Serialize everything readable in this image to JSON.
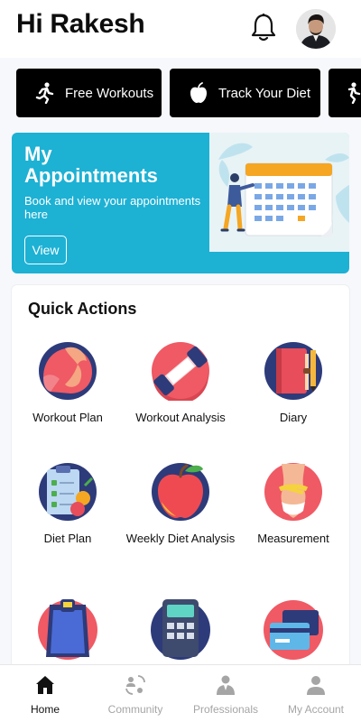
{
  "header": {
    "greeting": "Hi Rakesh"
  },
  "chips": [
    {
      "label": "Free Workouts",
      "icon": "running-person-icon"
    },
    {
      "label": "Track Your Diet",
      "icon": "apple-icon"
    },
    {
      "label": "",
      "icon": "running-person-icon"
    }
  ],
  "banner": {
    "title_line1": "My",
    "title_line2": "Appointments",
    "subtitle": "Book and view your appointments here",
    "button": "View",
    "accent": "#1db1d4"
  },
  "quick_actions": {
    "title": "Quick Actions",
    "items": [
      {
        "label": "Workout Plan",
        "icon": "flexed-arm-icon"
      },
      {
        "label": "Workout Analysis",
        "icon": "dumbbell-icon"
      },
      {
        "label": "Diary",
        "icon": "diary-book-icon"
      },
      {
        "label": "Diet Plan",
        "icon": "diet-clipboard-icon"
      },
      {
        "label": "Weekly Diet Analysis",
        "icon": "apple-icon"
      },
      {
        "label": "Measurement",
        "icon": "measuring-tape-icon"
      },
      {
        "label": "",
        "icon": "weighing-scale-icon"
      },
      {
        "label": "",
        "icon": "calculator-icon"
      },
      {
        "label": "",
        "icon": "payment-cards-icon"
      }
    ]
  },
  "nav": {
    "active": "Home",
    "items": [
      {
        "label": "Home",
        "icon": "home-icon"
      },
      {
        "label": "Community",
        "icon": "community-icon"
      },
      {
        "label": "Professionals",
        "icon": "professional-icon"
      },
      {
        "label": "My Account",
        "icon": "user-icon"
      }
    ]
  }
}
